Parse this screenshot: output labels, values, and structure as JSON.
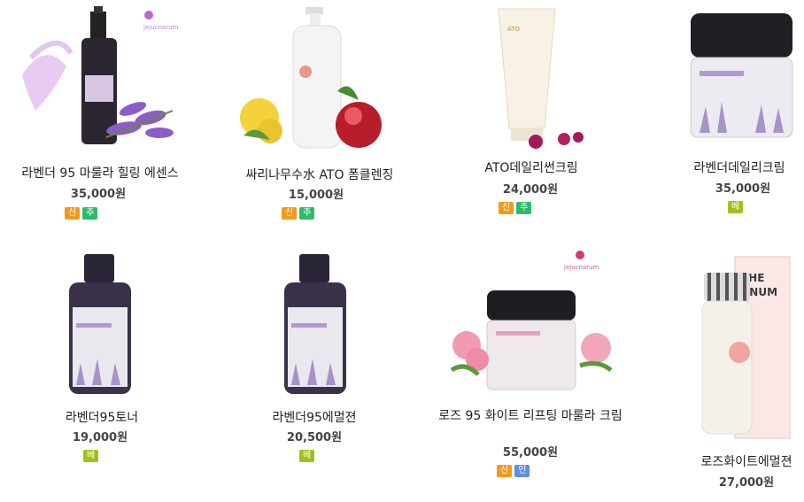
{
  "products": [
    {
      "name": "라벤더 95 마룰라 힐링 에센스",
      "price": "35,000원",
      "badges": [
        "신상품",
        "추천"
      ]
    },
    {
      "name": "싸리나무수水 ATO 폼클렌징",
      "price": "15,000원",
      "badges": [
        "신상품",
        "추천"
      ]
    },
    {
      "name": "ATO데일리썬크림",
      "price": "24,000원",
      "badges": [
        "신상품",
        "추천"
      ]
    },
    {
      "name": "라벤더데일리크림",
      "price": "35,000원",
      "badges": [
        "베스트"
      ]
    },
    {
      "name": "라벤더95토너",
      "price": "19,000원",
      "badges": [
        "베스트"
      ]
    },
    {
      "name": "라벤더95에멀젼",
      "price": "20,500원",
      "badges": [
        "베스트"
      ]
    },
    {
      "name": "로즈 95 화이트 리프팅 마룰라 크림",
      "price": "55,000원",
      "badges": [
        "신상품",
        "인기"
      ]
    },
    {
      "name": "로즈화이트에멀젼",
      "price": "27,000원",
      "badges": []
    }
  ],
  "brand": "jejucnarum",
  "colors": {
    "new": "#f39a1c",
    "recommend": "#2dbb6b",
    "best": "#9cc21b",
    "popular": "#5d8fe0"
  }
}
